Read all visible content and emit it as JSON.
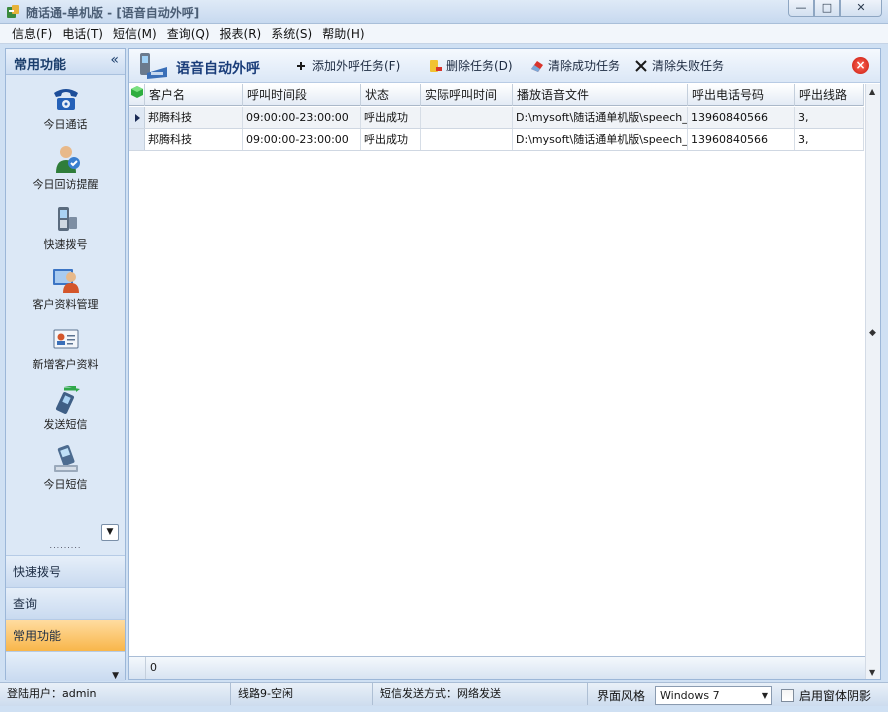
{
  "window": {
    "title": "随话通-单机版 - [语音自动外呼]"
  },
  "menu": [
    "信息(F)",
    "电话(T)",
    "短信(M)",
    "查询(Q)",
    "报表(R)",
    "系统(S)",
    "帮助(H)"
  ],
  "sidebar": {
    "title": "常用功能",
    "collapse_glyph": "«",
    "items": [
      {
        "label": "今日通话",
        "icon": "telephone-icon"
      },
      {
        "label": "今日回访提醒",
        "icon": "callback-reminder-icon"
      },
      {
        "label": "快速拨号",
        "icon": "mobile-phone-icon"
      },
      {
        "label": "客户资料管理",
        "icon": "customer-management-icon"
      },
      {
        "label": "新增客户资料",
        "icon": "contact-card-icon"
      },
      {
        "label": "发送短信",
        "icon": "send-sms-icon"
      },
      {
        "label": "今日短信",
        "icon": "sms-inbox-icon"
      }
    ],
    "nav": {
      "quick_dial": "快速拨号",
      "query": "查询",
      "common": "常用功能"
    }
  },
  "toolbar": {
    "title": "语音自动外呼",
    "add_task": "添加外呼任务(F)",
    "delete_task": "删除任务(D)",
    "clear_success": "清除成功任务",
    "clear_failed": "清除失败任务"
  },
  "grid": {
    "columns": [
      "客户名",
      "呼叫时间段",
      "状态",
      "实际呼叫时间",
      "播放语音文件",
      "呼出电话号码",
      "呼出线路"
    ],
    "rows": [
      [
        "邦腾科技",
        "09:00:00-23:00:00",
        "呼出成功",
        "",
        "D:\\mysoft\\随话通单机版\\speech_",
        "13960840566",
        "3,"
      ],
      [
        "邦腾科技",
        "09:00:00-23:00:00",
        "呼出成功",
        "",
        "D:\\mysoft\\随话通单机版\\speech_",
        "13960840566",
        "3,"
      ]
    ],
    "footer_count": "0"
  },
  "statusbar": {
    "user": "登陆用户：admin",
    "line": "线路9-空闲",
    "sms_mode": "短信发送方式：网络发送",
    "style_label": "界面风格",
    "style_value": "Windows 7",
    "shadow_label": "启用窗体阴影"
  },
  "colors": {
    "accent": "#1a3d7a",
    "nav_active": "#f8b64a",
    "close_red": "#c8170c"
  }
}
